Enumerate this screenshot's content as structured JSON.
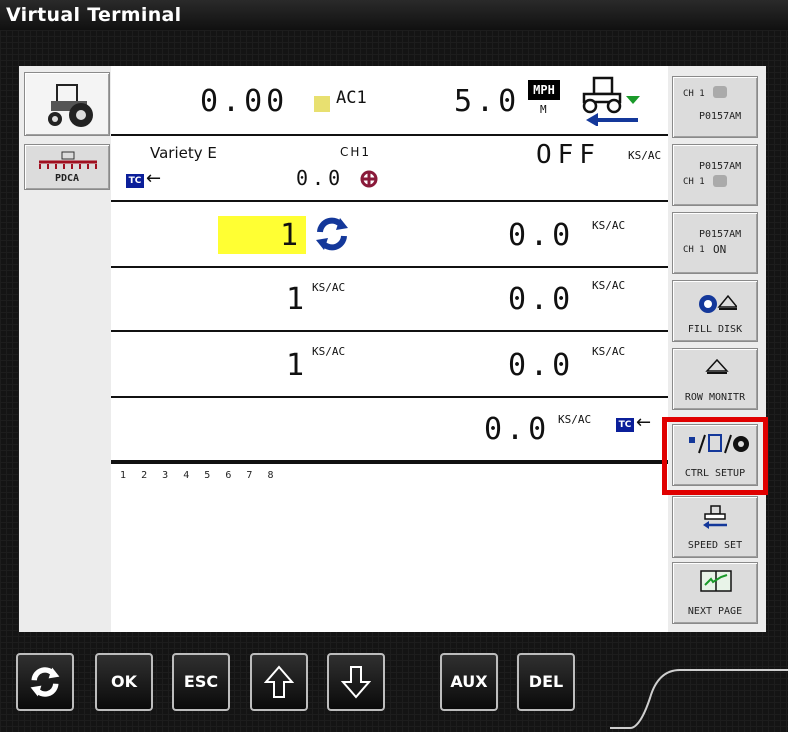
{
  "window": {
    "title": "Virtual Terminal"
  },
  "row1": {
    "rate": "0.00",
    "product": "AC1",
    "speed": "5.0",
    "speed_unit": "MPH",
    "speed_source": "M"
  },
  "row2": {
    "variety": "Variety E",
    "channel": "CH1",
    "value": "0.0",
    "status": "OFF",
    "unit": "KS/AC"
  },
  "row3": {
    "target": "1",
    "value": "0.0",
    "unit": "KS/AC"
  },
  "row4": {
    "value_left": "1",
    "value_right": "0.0",
    "unit": "KS/AC"
  },
  "row5": {
    "value_left": "1",
    "value_right": "0.0",
    "unit": "KS/AC"
  },
  "row6": {
    "value": "0.0",
    "unit": "KS/AC"
  },
  "row_numbers": [
    "1",
    "2",
    "3",
    "4",
    "5",
    "6",
    "7",
    "8"
  ],
  "left_keys": {
    "pdca_label": "PDCA"
  },
  "right_keys": {
    "k1_ch": "CH 1",
    "k1_id": "P0157AM",
    "k2_id": "P0157AM",
    "k2_ch": "CH 1",
    "k3_id": "P0157AM",
    "k3_ch": "CH 1",
    "k3_state": "ON",
    "k4_label": "FILL DISK",
    "k5_label": "ROW MONITR",
    "k6_label": "CTRL SETUP",
    "k7_label": "SPEED SET",
    "k8_label": "NEXT PAGE"
  },
  "bottom_buttons": {
    "ok": "OK",
    "esc": "ESC",
    "aux": "AUX",
    "del": "DEL"
  },
  "colors": {
    "highlight": "#ffff33",
    "tc_blue": "#0b1f9a",
    "red_outline": "#e00000"
  }
}
